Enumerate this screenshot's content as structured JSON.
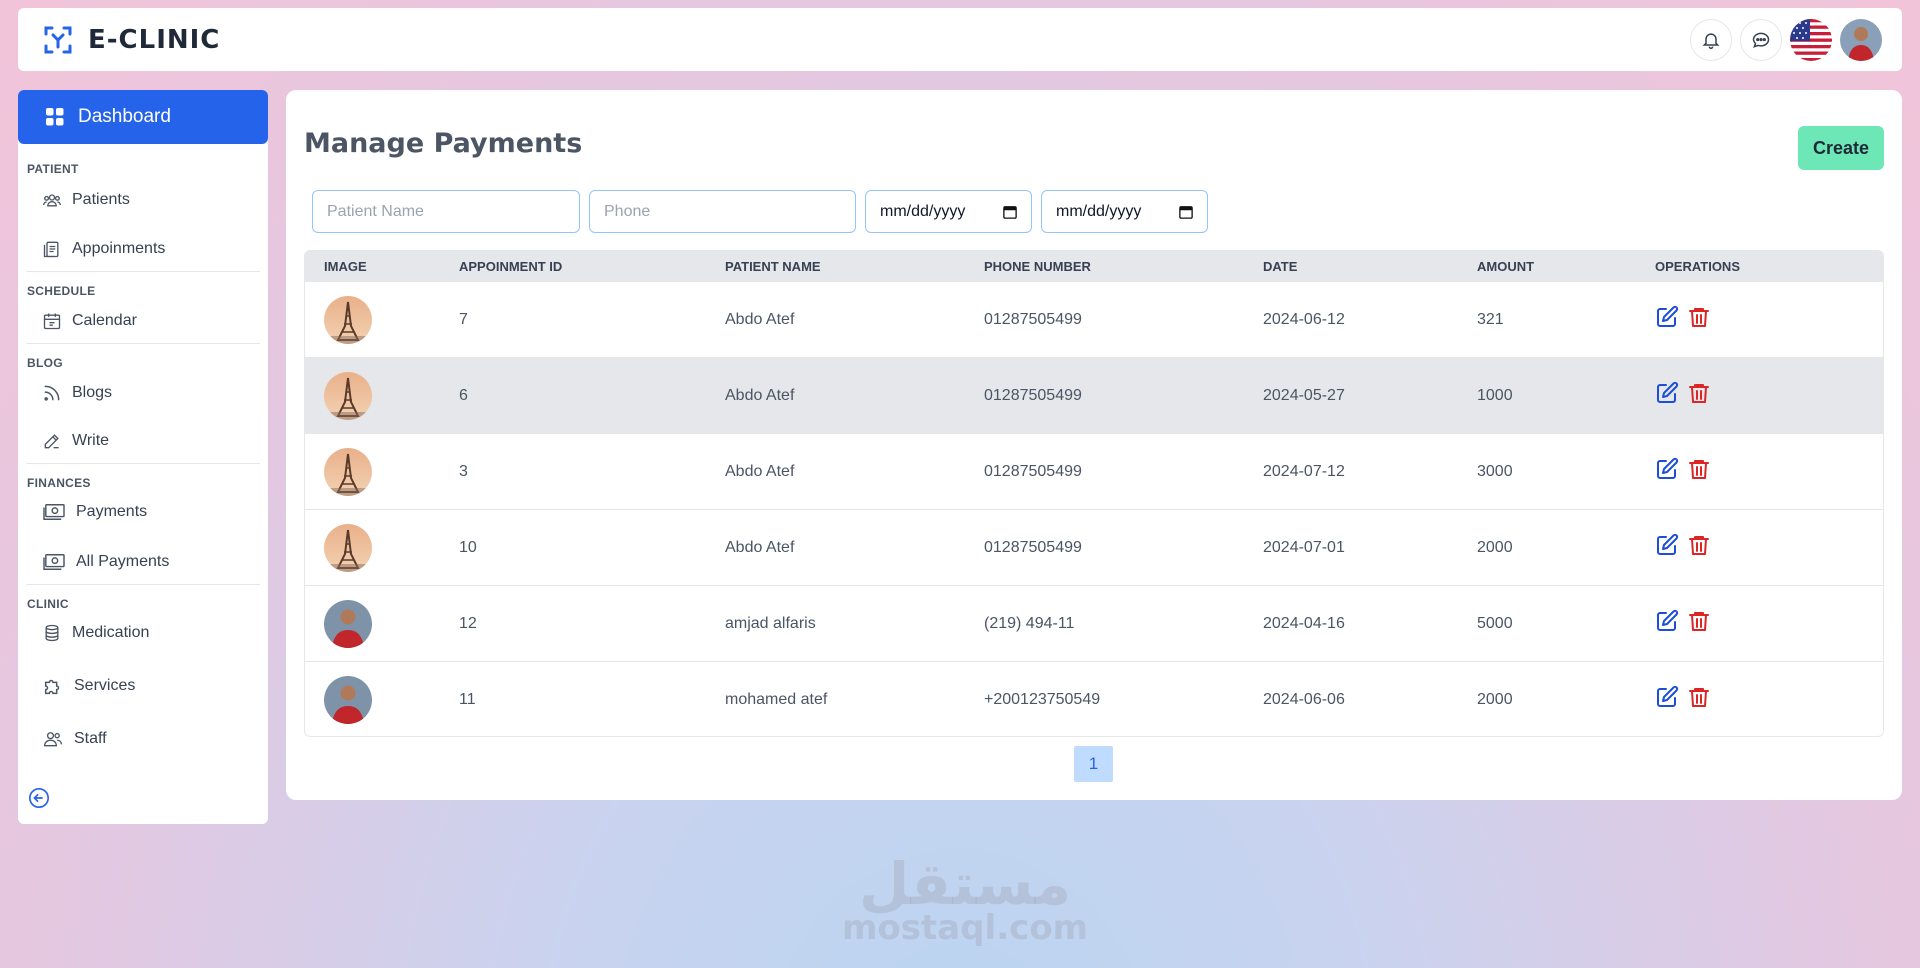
{
  "app": {
    "name": "E-CLINIC"
  },
  "sidebar": {
    "dashboard_label": "Dashboard",
    "sections": [
      {
        "label": "PATIENT",
        "items": [
          "Patients",
          "Appoinments"
        ]
      },
      {
        "label": "SCHEDULE",
        "items": [
          "Calendar"
        ]
      },
      {
        "label": "BLOG",
        "items": [
          "Blogs",
          "Write"
        ]
      },
      {
        "label": "FINANCES",
        "items": [
          "Payments",
          "All Payments"
        ]
      },
      {
        "label": "CLINIC",
        "items": [
          "Medication",
          "Services",
          "Staff"
        ]
      }
    ]
  },
  "main": {
    "title": "Manage Payments",
    "create_label": "Create",
    "filters": {
      "patient_name_placeholder": "Patient Name",
      "phone_placeholder": "Phone",
      "date_from": "mm/dd/yyyy",
      "date_to": "mm/dd/yyyy"
    },
    "table": {
      "columns": [
        "IMAGE",
        "APPOINMENT ID",
        "PATIENT NAME",
        "PHONE NUMBER",
        "DATE",
        "AMOUNT",
        "OPERATIONS"
      ],
      "rows": [
        {
          "image": "eiffel-photo",
          "id": "7",
          "name": "Abdo Atef",
          "phone": "01287505499",
          "date": "2024-06-12",
          "amount": "321"
        },
        {
          "image": "eiffel-photo",
          "id": "6",
          "name": "Abdo Atef",
          "phone": "01287505499",
          "date": "2024-05-27",
          "amount": "1000"
        },
        {
          "image": "eiffel-photo",
          "id": "3",
          "name": "Abdo Atef",
          "phone": "01287505499",
          "date": "2024-07-12",
          "amount": "3000"
        },
        {
          "image": "eiffel-photo",
          "id": "10",
          "name": "Abdo Atef",
          "phone": "01287505499",
          "date": "2024-07-01",
          "amount": "2000"
        },
        {
          "image": "person-photo",
          "id": "12",
          "name": "amjad alfaris",
          "phone": "(219) 494-11",
          "date": "2024-04-16",
          "amount": "5000"
        },
        {
          "image": "person-photo",
          "id": "11",
          "name": "mohamed atef",
          "phone": "+200123750549",
          "date": "2024-06-06",
          "amount": "2000"
        }
      ]
    },
    "pagination": {
      "current": "1"
    }
  },
  "watermark": {
    "arabic": "مستقل",
    "latin": "mostaql.com"
  },
  "colors": {
    "primary": "#2563eb",
    "create": "#6ee7b7",
    "delete": "#dc2626",
    "edit": "#1d4ed8"
  }
}
